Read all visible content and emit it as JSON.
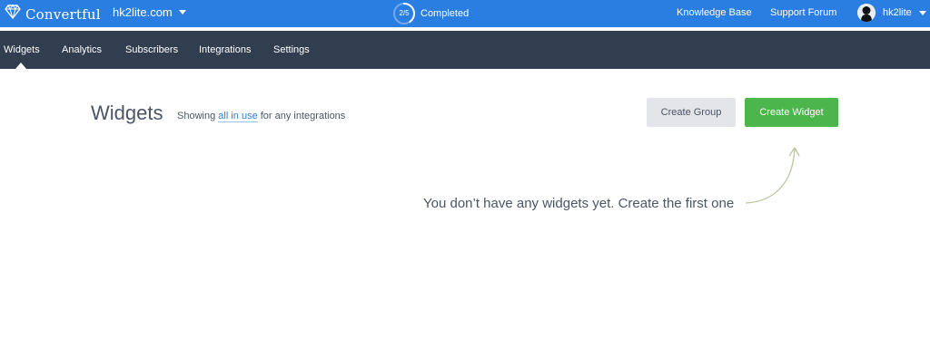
{
  "topbar": {
    "logo_text": "Convertful",
    "logo_icon": "diamond-logo-icon",
    "site": "hk2lite.com",
    "progress": {
      "label": "2/5",
      "status": "Completed",
      "fraction": 0.4
    },
    "links": [
      "Knowledge Base",
      "Support Forum"
    ],
    "user": "hk2lite"
  },
  "nav": {
    "items": [
      "Widgets",
      "Analytics",
      "Subscribers",
      "Integrations",
      "Settings"
    ],
    "active": "Widgets"
  },
  "main": {
    "title": "Widgets",
    "showing_prefix": "Showing",
    "filter_link": "all in use",
    "showing_suffix": "for any integrations",
    "create_group": "Create Group",
    "create_widget": "Create Widget",
    "empty_message": "You don’t have any widgets yet. Create the first one"
  },
  "colors": {
    "topbar": "#2a7de1",
    "navbar": "#303e4f",
    "primary_button": "#4cb54b",
    "secondary_button": "#e3e5e8",
    "link": "#2a7de1",
    "arrow": "#b7c59c"
  }
}
